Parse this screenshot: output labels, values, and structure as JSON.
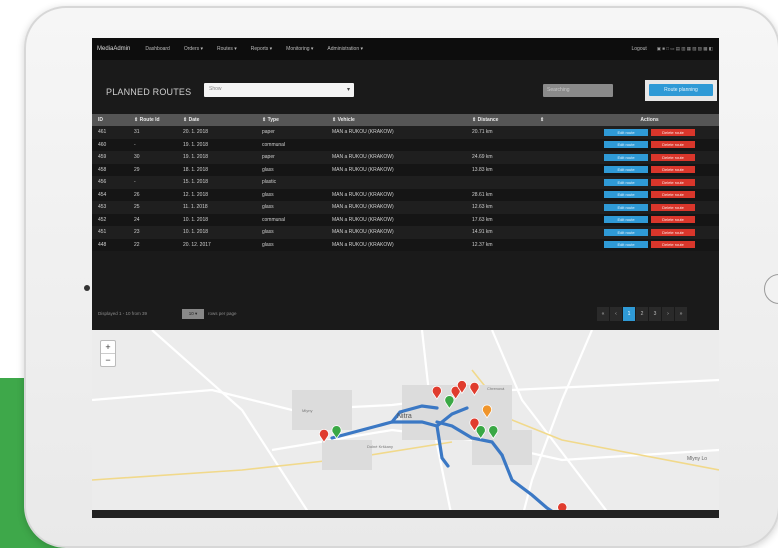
{
  "nav": {
    "brand": "MediaAdmin",
    "items": [
      "Dashboard",
      "Orders ▾",
      "Routes ▾",
      "Reports ▾",
      "Monitoring ▾",
      "Administration ▾"
    ],
    "logout": "Logout",
    "languages": "▣ ■ □ ▭ ▤ ▥ ▦ ▧ ▨ ▩ ◧"
  },
  "header": {
    "title": "PLANNED ROUTES",
    "select_placeholder": "Show",
    "search_placeholder": "Searching",
    "add_button": "Route planning"
  },
  "table": {
    "columns": [
      "ID",
      "Route Id",
      "Date",
      "Type",
      "Vehicle",
      "Distance",
      "",
      "Actions"
    ],
    "rows": [
      [
        "461",
        "31",
        "20. 1. 2018",
        "paper",
        "MAN a RUKOU (KRAKOW)",
        "20.71 km"
      ],
      [
        "460",
        "-",
        "19. 1. 2018",
        "communal",
        "",
        ""
      ],
      [
        "459",
        "30",
        "19. 1. 2018",
        "paper",
        "MAN a RUKOU (KRAKOW)",
        "24.69 km"
      ],
      [
        "458",
        "29",
        "18. 1. 2018",
        "glass",
        "MAN a RUKOU (KRAKOW)",
        "13.83 km"
      ],
      [
        "456",
        "-",
        "15. 1. 2018",
        "plastic",
        "",
        ""
      ],
      [
        "454",
        "26",
        "12. 1. 2018",
        "glass",
        "MAN a RUKOU (KRAKOW)",
        "28.61 km"
      ],
      [
        "453",
        "25",
        "11. 1. 2018",
        "glass",
        "MAN a RUKOU (KRAKOW)",
        "12.63 km"
      ],
      [
        "452",
        "24",
        "10. 1. 2018",
        "communal",
        "MAN a RUKOU (KRAKOW)",
        "17.63 km"
      ],
      [
        "451",
        "23",
        "10. 1. 2018",
        "glass",
        "MAN a RUKOU (KRAKOW)",
        "14.91 km"
      ],
      [
        "448",
        "22",
        "20. 12. 2017",
        "glass",
        "MAN a RUKOU (KRAKOW)",
        "12.37 km"
      ]
    ],
    "edit_label": "Edit route",
    "delete_label": "Delete route"
  },
  "footer": {
    "showing": "Displayed 1 - 10 from 39",
    "per_page": "10 ▾",
    "per_page_label": "rows per page",
    "pages": [
      "«",
      "‹",
      "1",
      "2",
      "3",
      "›",
      "»"
    ],
    "active_page": "1"
  },
  "map": {
    "city": "Nitra",
    "labels": [
      "Mlyny",
      "Dolné Krškany",
      "Chrenová",
      "Mlyny Lo"
    ],
    "markers": [
      {
        "lng": 0.37,
        "lat": 0.56,
        "color": "#e03c2e"
      },
      {
        "lng": 0.39,
        "lat": 0.54,
        "color": "#3aa845"
      },
      {
        "lng": 0.55,
        "lat": 0.33,
        "color": "#e03c2e"
      },
      {
        "lng": 0.57,
        "lat": 0.38,
        "color": "#3aa845"
      },
      {
        "lng": 0.58,
        "lat": 0.33,
        "color": "#e03c2e"
      },
      {
        "lng": 0.59,
        "lat": 0.3,
        "color": "#e03c2e"
      },
      {
        "lng": 0.61,
        "lat": 0.31,
        "color": "#e03c2e"
      },
      {
        "lng": 0.63,
        "lat": 0.43,
        "color": "#f0952b"
      },
      {
        "lng": 0.61,
        "lat": 0.5,
        "color": "#e03c2e"
      },
      {
        "lng": 0.62,
        "lat": 0.54,
        "color": "#3aa845"
      },
      {
        "lng": 0.64,
        "lat": 0.54,
        "color": "#3aa845"
      },
      {
        "lng": 0.75,
        "lat": 0.95,
        "color": "#e03c2e"
      }
    ],
    "colors": {
      "route": "#3b78c4"
    }
  }
}
